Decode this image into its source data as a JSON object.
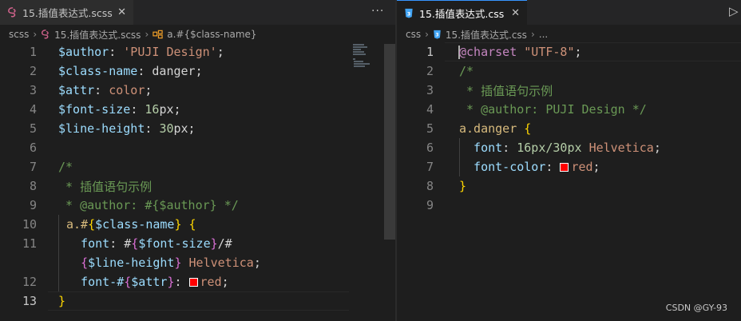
{
  "left_editor": {
    "tab_title": "15.插值表达式.scss",
    "tab_icon": "scss-file-icon",
    "breadcrumb": [
      "scss",
      "15.插值表达式.scss",
      "a.#{$class-name}"
    ],
    "more_actions": "···",
    "line_numbers": [
      "1",
      "2",
      "3",
      "4",
      "5",
      "6",
      "7",
      "8",
      "9",
      "10",
      "11",
      "12",
      "13"
    ],
    "lines": [
      {
        "t1": "$author",
        "t2": ": ",
        "t3": "'PUJI Design'",
        "t4": ";"
      },
      {
        "t1": "$class-name",
        "t2": ": ",
        "t3": "danger",
        "t4": ";"
      },
      {
        "t1": "$attr",
        "t2": ": ",
        "t3": "color",
        "t4": ";"
      },
      {
        "t1": "$font-size",
        "t2": ": ",
        "t3": "16",
        "t4": "px;"
      },
      {
        "t1": "$line-height",
        "t2": ": ",
        "t3": "30",
        "t4": "px;"
      },
      {},
      {
        "t1": "/*"
      },
      {
        "t1": " * 插值语句示例"
      },
      {
        "t1": " * @author: #{$author} */"
      },
      {
        "a": "a.#",
        "b": "{",
        "c": "$class-name",
        "d": "}",
        "e": " ",
        "f": "{"
      },
      {
        "a": "  font",
        "b": ": ",
        "c": "#",
        "d": "{",
        "e": "$font-size",
        "f": "}",
        "g": "/#"
      },
      {
        "a": "  ",
        "b": "{",
        "c": "$line-height",
        "d": "}",
        "e": " ",
        "f": "Helvetica",
        "g": ";"
      },
      {
        "a": "  font-#",
        "b": "{",
        "c": "$attr",
        "d": "}",
        "e": ": ",
        "f": "red",
        "g": ";"
      },
      {
        "a": "}"
      }
    ]
  },
  "right_editor": {
    "tab_title": "15.插值表达式.css",
    "tab_icon": "css-file-icon",
    "breadcrumb": [
      "css",
      "15.插值表达式.css",
      "..."
    ],
    "run_action": "▷",
    "line_numbers": [
      "1",
      "2",
      "3",
      "4",
      "5",
      "6",
      "7",
      "8",
      "9"
    ],
    "lines": [
      {
        "a": "@charset",
        "b": " ",
        "c": "\"UTF-8\"",
        "d": ";"
      },
      {
        "a": "/*"
      },
      {
        "a": " * 插值语句示例"
      },
      {
        "a": " * @author: PUJI Design */"
      },
      {
        "a": "a.danger",
        "b": " ",
        "c": "{"
      },
      {
        "a": "  font",
        "b": ": ",
        "c": "16px/30px",
        "d": " ",
        "e": "Helvetica",
        "f": ";"
      },
      {
        "a": "  font-color",
        "b": ": ",
        "c": "red",
        "d": ";"
      },
      {
        "a": "}"
      },
      {}
    ]
  },
  "watermark": "CSDN @GY-93",
  "colors": {
    "accent": "#3794ff",
    "swatch_red": "#ff0000"
  }
}
